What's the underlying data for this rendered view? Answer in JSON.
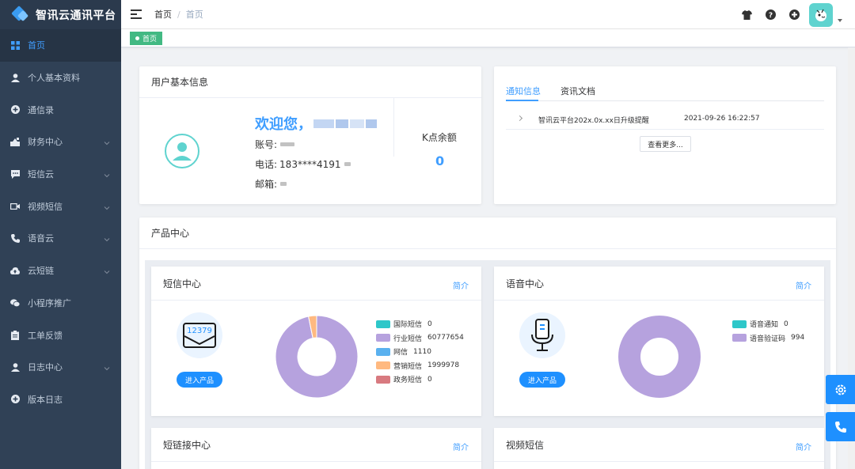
{
  "app": {
    "title": "智讯云通讯平台"
  },
  "sidebar": {
    "items": [
      {
        "label": "首页",
        "icon": "grid-icon",
        "active": true,
        "expandable": false
      },
      {
        "label": "个人基本资料",
        "icon": "user-icon",
        "active": false,
        "expandable": false
      },
      {
        "label": "通信录",
        "icon": "plus-circle-icon",
        "active": false,
        "expandable": false
      },
      {
        "label": "财务中心",
        "icon": "finance-icon",
        "active": false,
        "expandable": true
      },
      {
        "label": "短信云",
        "icon": "message-icon",
        "active": false,
        "expandable": true
      },
      {
        "label": "视频短信",
        "icon": "video-icon",
        "active": false,
        "expandable": true
      },
      {
        "label": "语音云",
        "icon": "phone-icon",
        "active": false,
        "expandable": true
      },
      {
        "label": "云短链",
        "icon": "cloud-icon",
        "active": false,
        "expandable": true
      },
      {
        "label": "小程序推广",
        "icon": "wechat-icon",
        "active": false,
        "expandable": false
      },
      {
        "label": "工单反馈",
        "icon": "clipboard-icon",
        "active": false,
        "expandable": false
      },
      {
        "label": "日志中心",
        "icon": "user-icon",
        "active": false,
        "expandable": true
      },
      {
        "label": "版本日志",
        "icon": "plus-circle-icon",
        "active": false,
        "expandable": false
      }
    ]
  },
  "breadcrumb": {
    "home": "首页",
    "separator": "/",
    "current": "首页"
  },
  "tags": {
    "active": "首页"
  },
  "user_card": {
    "title": "用户基本信息",
    "welcome": "欢迎您，",
    "account_label": "账号:",
    "phone_label": "电话:",
    "phone_value": "183****4191",
    "email_label": "邮箱:",
    "balance_label": "K点余额",
    "balance_value": "0"
  },
  "notice_card": {
    "tabs": [
      "通知信息",
      "资讯文档"
    ],
    "active_tab": 0,
    "rows": [
      {
        "title": "智讯云平台202x.0x.xx日升级提醒",
        "time": "2021-09-26 16:22:57"
      }
    ],
    "more_button": "查看更多..."
  },
  "product_center": {
    "title": "产品中心",
    "sms": {
      "title": "短信中心",
      "intro": "简介",
      "enter": "进入产品",
      "icon_label": "12379",
      "legend": [
        {
          "name": "国际短信",
          "value": "0",
          "color": "#2ec7c9"
        },
        {
          "name": "行业短信",
          "value": "60777654",
          "color": "#b6a2de"
        },
        {
          "name": "网信",
          "value": "1110",
          "color": "#5ab1ef"
        },
        {
          "name": "营销短信",
          "value": "1999978",
          "color": "#ffb980"
        },
        {
          "name": "政务短信",
          "value": "0",
          "color": "#d87a80"
        }
      ]
    },
    "voice": {
      "title": "语音中心",
      "intro": "简介",
      "enter": "进入产品",
      "legend": [
        {
          "name": "语音通知",
          "value": "0",
          "color": "#2ec7c9"
        },
        {
          "name": "语音验证码",
          "value": "994",
          "color": "#b6a2de"
        }
      ]
    },
    "shortlink": {
      "title": "短链接中心",
      "intro": "简介"
    },
    "video": {
      "title": "视频短信",
      "intro": "简介"
    }
  },
  "chart_data": [
    {
      "type": "pie",
      "categories": [
        "国际短信",
        "行业短信",
        "网信",
        "营销短信",
        "政务短信"
      ],
      "values": [
        0,
        60777654,
        1110,
        1999978,
        0
      ],
      "colors": [
        "#2ec7c9",
        "#b6a2de",
        "#5ab1ef",
        "#ffb980",
        "#d87a80"
      ],
      "legend": "right"
    },
    {
      "type": "pie",
      "categories": [
        "语音通知",
        "语音验证码"
      ],
      "values": [
        0,
        994
      ],
      "colors": [
        "#2ec7c9",
        "#b6a2de"
      ],
      "legend": "right"
    }
  ],
  "colors": {
    "sidebar_bg": "#304156",
    "accent": "#409eff",
    "tag_green": "#42b983",
    "float_blue": "#1e90ff"
  }
}
